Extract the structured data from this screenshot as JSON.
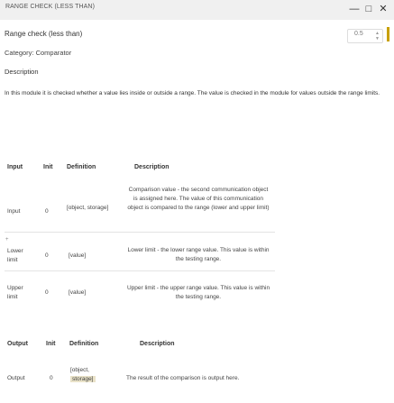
{
  "window": {
    "title": "RANGE CHECK (LESS THAN)",
    "buttons": {
      "minimize": "—",
      "restore": "□",
      "close": "✕"
    },
    "counter_value": "0.5"
  },
  "module": {
    "heading": "Range check (less than)",
    "category": "Category: Comparator",
    "description_heading": "Description",
    "description_text": "In this module it is checked whether a value lies inside or outside a range. The value is checked in the module for values outside the range limits."
  },
  "inputs_table": {
    "headers": {
      "name": "Input",
      "init": "Init",
      "definition": "Definition",
      "description": "Description"
    },
    "rows": [
      {
        "name": "Input",
        "init": "0",
        "definition": "[object, storage]",
        "description": "Comparison value - the second communication object is assigned here. The value of this communication object is compared to the range (lower and upper limit)"
      },
      {
        "name": "Lower limit",
        "init": "0",
        "definition": "[value]",
        "description": "Lower limit - the lower range value. This value is within the testing range."
      },
      {
        "name": "Upper limit",
        "init": "0",
        "definition": "[value]",
        "description": "Upper limit - the upper range value. This value is within the testing range."
      }
    ]
  },
  "outputs_table": {
    "headers": {
      "name": "Output",
      "init": "Init",
      "definition": "Definition",
      "description": "Description"
    },
    "rows": [
      {
        "name": "Output",
        "init": "0",
        "definition_part1": "[object,",
        "definition_part2": "storage]",
        "description": "The result of the comparison is output here."
      }
    ]
  },
  "icons": {
    "drag_handle": "drag-handle-icon",
    "minimize": "minimize-icon",
    "restore": "restore-icon",
    "close": "close-icon"
  },
  "colors": {
    "accent": "#c8a000",
    "highlight": "#e9e2c8"
  }
}
